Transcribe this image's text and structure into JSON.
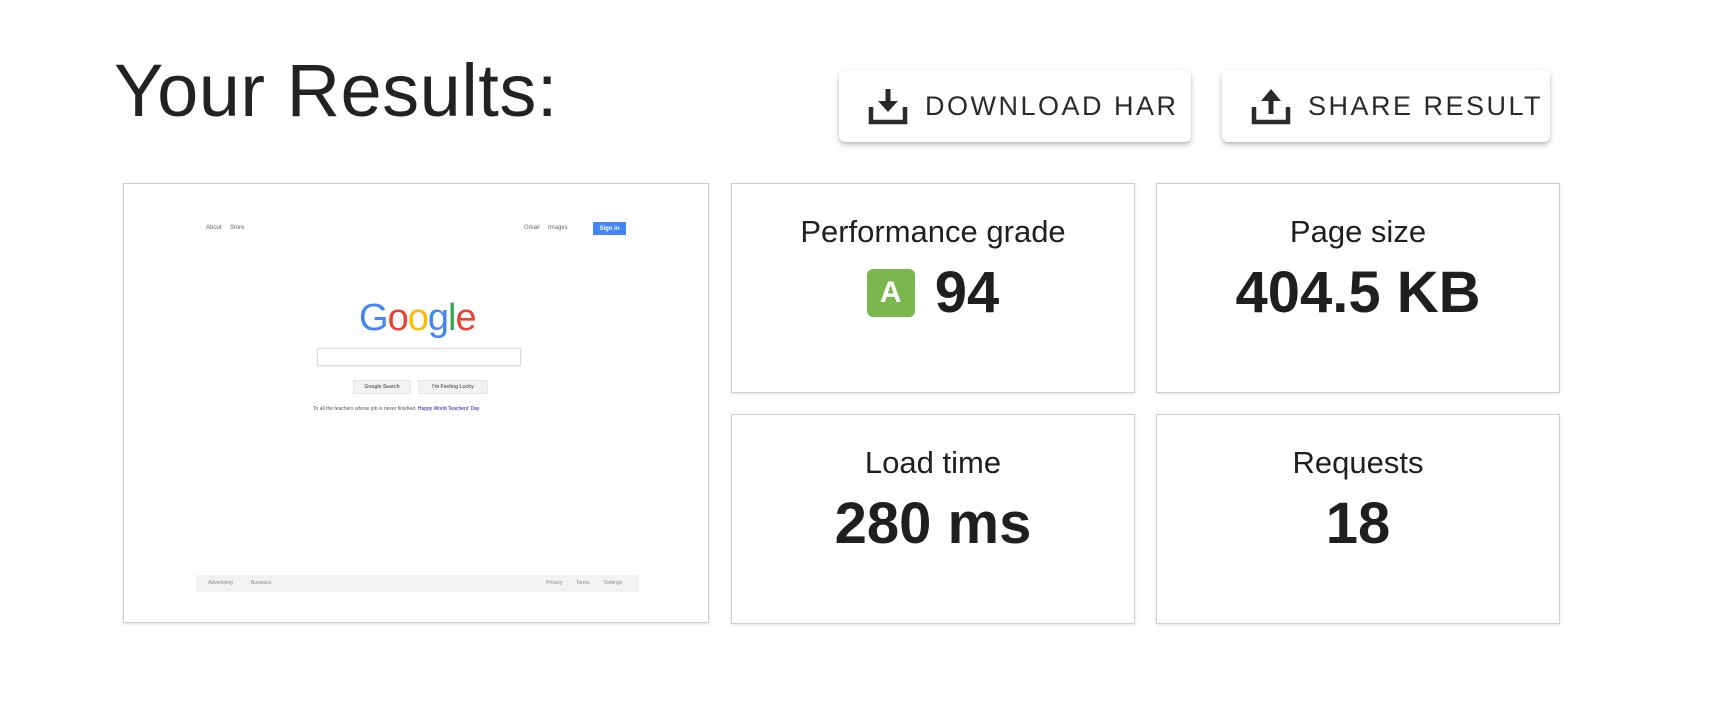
{
  "header": {
    "title": "Your Results:"
  },
  "actions": {
    "download_label": "DOWNLOAD HAR",
    "share_label": "SHARE RESULT",
    "download_icon": "download-icon",
    "share_icon": "share-icon"
  },
  "metrics": {
    "performance": {
      "label": "Performance grade",
      "grade": "A",
      "score": "94",
      "grade_color": "#7ab84e"
    },
    "page_size": {
      "label": "Page size",
      "value": "404.5 KB"
    },
    "load_time": {
      "label": "Load time",
      "value": "280 ms"
    },
    "requests": {
      "label": "Requests",
      "value": "18"
    }
  },
  "screenshot": {
    "top_links": [
      "About",
      "Store"
    ],
    "top_right_links": [
      "Gmail",
      "Images"
    ],
    "sign_in": "Sign in",
    "logo_letters": [
      {
        "char": "G",
        "color": "#4285f4"
      },
      {
        "char": "o",
        "color": "#ea4335"
      },
      {
        "char": "o",
        "color": "#fbbc05"
      },
      {
        "char": "g",
        "color": "#4285f4"
      },
      {
        "char": "l",
        "color": "#34a853"
      },
      {
        "char": "e",
        "color": "#ea4335"
      }
    ],
    "search_button": "Google Search",
    "lucky_button": "I'm Feeling Lucky",
    "tagline": "To all the teachers whose job is never finished.",
    "tagline_link": "Happy World Teachers' Day",
    "footer_left": [
      "Advertising",
      "Business"
    ],
    "footer_right": [
      "Privacy",
      "Terms",
      "Settings"
    ]
  }
}
